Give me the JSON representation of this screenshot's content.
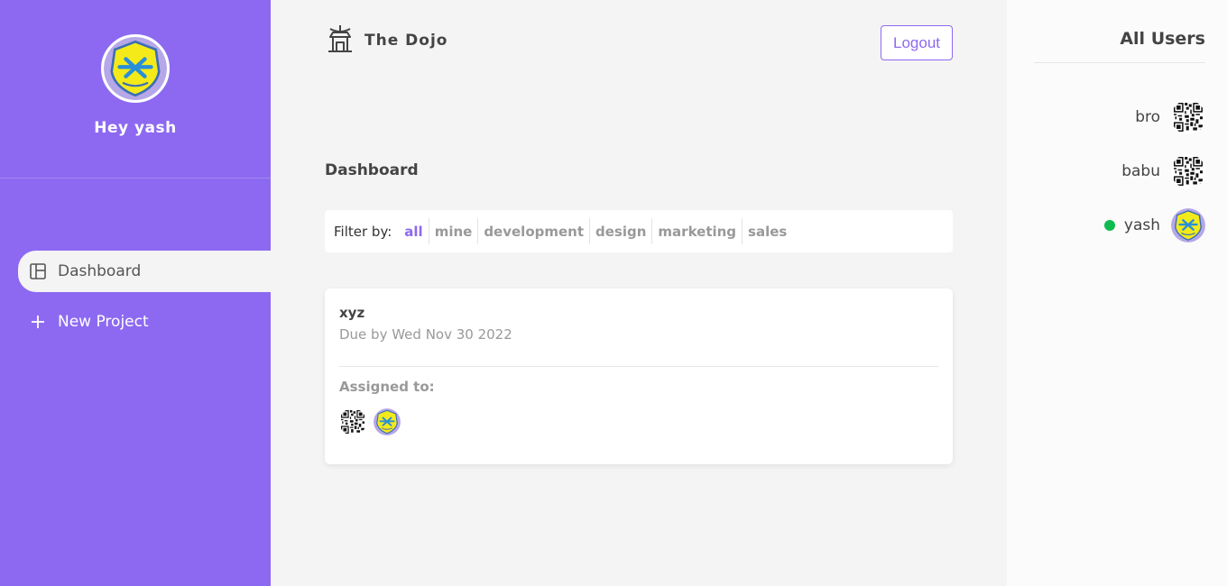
{
  "sidebar": {
    "greeting": "Hey yash",
    "nav": [
      {
        "label": "Dashboard",
        "icon": "dashboard-icon",
        "active": true
      },
      {
        "label": "New Project",
        "icon": "plus-icon",
        "active": false
      }
    ]
  },
  "header": {
    "brand": "The Dojo",
    "logout_label": "Logout"
  },
  "dashboard": {
    "title": "Dashboard",
    "filter": {
      "label": "Filter by:",
      "options": [
        "all",
        "mine",
        "development",
        "design",
        "marketing",
        "sales"
      ],
      "selected": "all"
    },
    "projects": [
      {
        "name": "xyz",
        "due": "Due by Wed Nov 30 2022",
        "assigned_label": "Assigned to:"
      }
    ]
  },
  "users": {
    "title": "All Users",
    "list": [
      {
        "name": "bro",
        "online": false,
        "avatar": "qr-code-avatar"
      },
      {
        "name": "babu",
        "online": false,
        "avatar": "qr-code-avatar"
      },
      {
        "name": "yash",
        "online": true,
        "avatar": "badge-avatar"
      }
    ]
  },
  "colors": {
    "accent": "#8d69f1",
    "online": "#0ebb50",
    "background": "#f4f4f4"
  }
}
